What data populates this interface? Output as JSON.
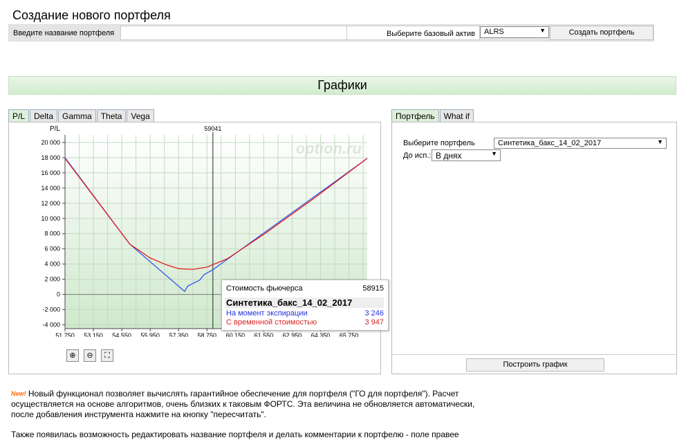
{
  "page_title": "Создание нового портфеля",
  "create": {
    "name_label": "Введите название портфеля",
    "name_value": "",
    "asset_label": "Выберите базовый актив",
    "asset_value": "ALRS",
    "create_button": "Создать портфель"
  },
  "section_title": "Графики",
  "chart_tabs": [
    "P/L",
    "Delta",
    "Gamma",
    "Theta",
    "Vega"
  ],
  "right_tabs": [
    "Портфель",
    "What if"
  ],
  "watermark": "option.ru",
  "portfolio": {
    "select_label": "Выберите портфель",
    "select_value": "Синтетика_бакс_14_02_2017",
    "until_label": "До исп.:",
    "until_value": "В днях",
    "build_button": "Построить график"
  },
  "tooltip": {
    "futures_label": "Стоимость фьючерса",
    "futures_value": "58915",
    "portfolio_name": "Синтетика_бакс_14_02_2017",
    "expiry_label": "На момент экспирации",
    "expiry_value": "3 246",
    "time_label": "С временной стоимостью",
    "time_value": "3 947"
  },
  "zoom_icons": [
    "zoom-in-icon",
    "zoom-out-icon",
    "zoom-fit-icon"
  ],
  "news": {
    "badge": "New!",
    "text1": "Новый функционал позволяет вычислять гарантийное обеспечение для портфеля (\"ГО для портфеля\"). Расчет осуществляется на основе алгоритмов, очень близких к таковым ФОРТС. Эта величина не обновляется автоматически, после добавления инструмента нажмите на кнопку \"пересчитать\".",
    "text2": "Также появилась возможность редактировать название портфеля и делать комментарии к портфелю - поле правее"
  },
  "chart_data": {
    "type": "line",
    "ylabel": "P/L",
    "cursor_label": "59041",
    "cursor_x": 59041,
    "xlim": [
      51750,
      66650
    ],
    "ylim": [
      -4500,
      21000
    ],
    "x_ticks": [
      51750,
      53150,
      54550,
      55950,
      57350,
      58750,
      60150,
      61550,
      62950,
      64350,
      65750
    ],
    "x_tick_labels": [
      "51 750",
      "53 150",
      "54 550",
      "55 950",
      "57 350",
      "58 750",
      "60 150",
      "61 550",
      "62 950",
      "64 350",
      "65 750"
    ],
    "y_ticks": [
      -4000,
      -2000,
      0,
      2000,
      4000,
      6000,
      8000,
      10000,
      12000,
      14000,
      16000,
      18000,
      20000
    ],
    "y_tick_labels": [
      "-4 000",
      "-2 000",
      "0",
      "2 000",
      "4 000",
      "6 000",
      "8 000",
      "10 000",
      "12 000",
      "14 000",
      "16 000",
      "18 000",
      "20 000"
    ],
    "grid": true,
    "series": [
      {
        "color": "#3355ee",
        "x": [
          51750,
          54950,
          57650,
          57800,
          58100,
          58400,
          58600,
          59041,
          66650
        ],
        "y": [
          18000,
          6600,
          400,
          1100,
          1500,
          1900,
          2600,
          3246,
          17900
        ]
      },
      {
        "color": "#e02020",
        "x": [
          51750,
          54950,
          55950,
          56750,
          57350,
          58050,
          58750,
          59750,
          61550,
          63950,
          66650
        ],
        "y": [
          17900,
          6600,
          4800,
          3900,
          3400,
          3300,
          3600,
          4700,
          7900,
          12500,
          17900
        ]
      }
    ]
  }
}
